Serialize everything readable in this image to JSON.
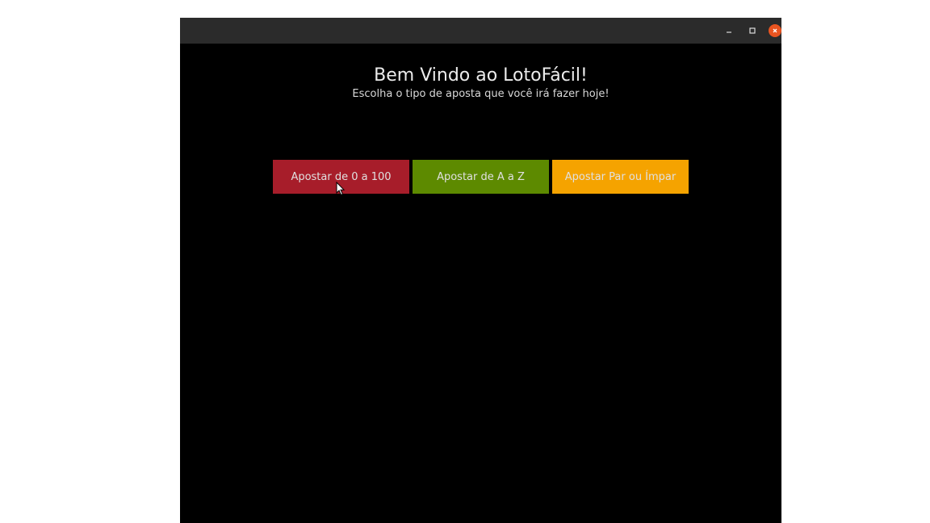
{
  "window": {
    "titlebar": {
      "minimize_icon": "minimize-icon",
      "maximize_icon": "maximize-icon",
      "close_icon": "close-icon",
      "close_color": "#e95420"
    }
  },
  "main": {
    "title": "Bem Vindo ao LotoFácil!",
    "subtitle": "Escolha o tipo de aposta que você irá fazer hoje!",
    "buttons": [
      {
        "label": "Apostar de 0 a 100",
        "color": "#a71d2a"
      },
      {
        "label": "Apostar de A a Z",
        "color": "#5d8a00"
      },
      {
        "label": "Apostar Par ou Ímpar",
        "color": "#f5a300"
      }
    ]
  }
}
